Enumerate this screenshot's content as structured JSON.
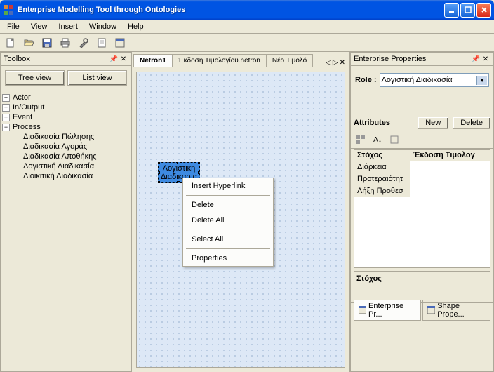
{
  "window": {
    "title": "Enterprise Modelling Tool through Ontologies"
  },
  "menubar": [
    "File",
    "View",
    "Insert",
    "Window",
    "Help"
  ],
  "toolbox": {
    "title": "Toolbox",
    "tree_view_btn": "Tree view",
    "list_view_btn": "List view",
    "nodes": [
      {
        "label": "Actor",
        "expanded": false
      },
      {
        "label": "In/Output",
        "expanded": false
      },
      {
        "label": "Event",
        "expanded": false
      },
      {
        "label": "Process",
        "expanded": true,
        "children": [
          "Διαδικασία Πώλησης",
          "Διαδικασία Αγοράς",
          "Διαδικασία Αποθήκης",
          "Λογιστική Διαδικασία",
          "Διοικιτική Διαδικασία"
        ]
      }
    ]
  },
  "tabs": {
    "items": [
      "Netron1",
      "Έκδοση Τιμολογίου.netron",
      "Νέο Τιμολό"
    ],
    "active": 0
  },
  "shape": {
    "label": "Λογιστικη Διαδικασια"
  },
  "context_menu": [
    "Insert Hyperlink",
    "-",
    "Delete",
    "Delete All",
    "-",
    "Select All",
    "-",
    "Properties"
  ],
  "properties": {
    "title": "Enterprise Properties",
    "role_label": "Role :",
    "role_value": "Λογιστική Διαδικασία",
    "attributes_label": "Attributes",
    "new_btn": "New",
    "delete_btn": "Delete",
    "grid": {
      "header_left": "Στόχος",
      "header_right": "Έκδοση Τιμολογ",
      "rows": [
        "Διάρκεια",
        "Προτεραιότητ",
        "Λήξη Προθεσ"
      ]
    },
    "description_title": "Στόχος"
  },
  "bottom_tabs": [
    "Enterprise Pr...",
    "Shape Prope..."
  ]
}
